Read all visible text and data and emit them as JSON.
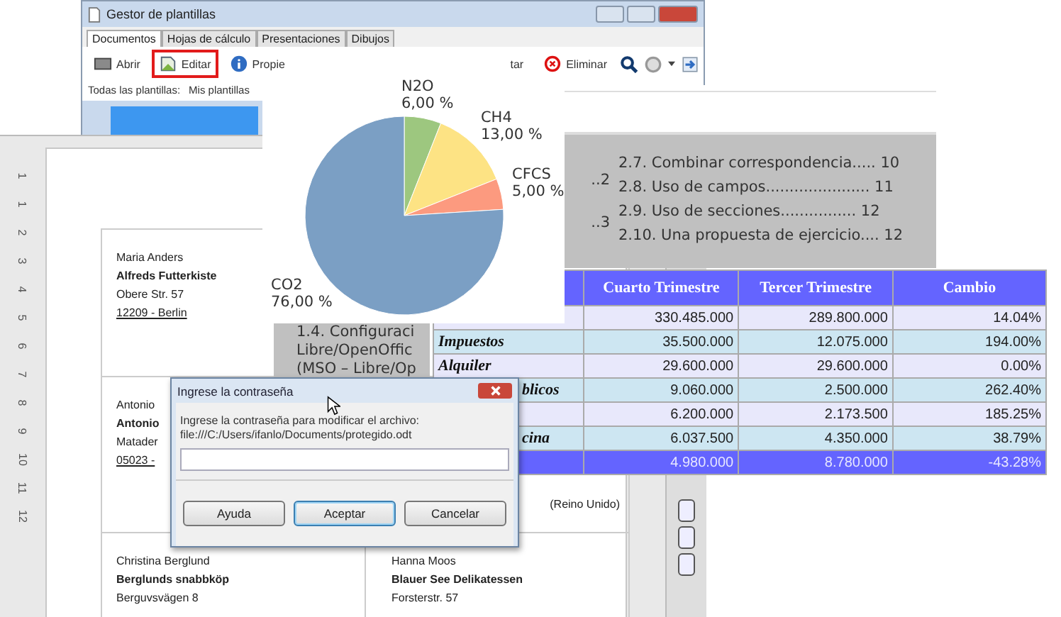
{
  "template_manager": {
    "title": "Gestor de plantillas",
    "tabs": [
      {
        "label": "Documentos",
        "selected": true
      },
      {
        "label": "Hojas de cálculo",
        "selected": false
      },
      {
        "label": "Presentaciones",
        "selected": false
      },
      {
        "label": "Dibujos",
        "selected": false
      }
    ],
    "toolbar": [
      {
        "label": "Abrir",
        "highlighted": false
      },
      {
        "label": "Editar",
        "highlighted": true
      },
      {
        "label": "Propie",
        "highlighted": false
      }
    ],
    "toolbar_right": [
      {
        "label": "tar"
      },
      {
        "label": "Eliminar"
      }
    ],
    "breadcrumb": [
      "Todas las plantillas:",
      "Mis plantillas"
    ]
  },
  "document": {
    "ruler": [
      "1",
      "1",
      "2",
      "3",
      "4",
      "5",
      "6",
      "7",
      "8",
      "9",
      "10",
      "11",
      "12"
    ],
    "rows": [
      {
        "left": {
          "lines": [
            {
              "text": "Maria Anders",
              "kind": "name"
            },
            {
              "text": "Alfreds Futterkiste",
              "kind": "company"
            },
            {
              "text": "Obere Str. 57",
              "kind": "street"
            },
            {
              "text": "12209 - Berlin",
              "kind": "city"
            }
          ]
        },
        "right": {}
      },
      {
        "left": {
          "lines": [
            {
              "text": "Antonio",
              "kind": "name"
            },
            {
              "text": "Antonio",
              "kind": "company"
            },
            {
              "text": "Matader",
              "kind": "street"
            },
            {
              "text": "05023 -",
              "kind": "city"
            }
          ]
        },
        "right": {
          "lines": [
            {
              "text": "(Reino Unido)",
              "kind": "country"
            }
          ]
        }
      },
      {
        "left": {
          "lines": [
            {
              "text": "Christina Berglund",
              "kind": "name"
            },
            {
              "text": "Berglunds snabbköp",
              "kind": "company"
            },
            {
              "text": "Berguvsvägen 8",
              "kind": "street"
            }
          ]
        },
        "right": {
          "lines": [
            {
              "text": "Hanna Moos",
              "kind": "name"
            },
            {
              "text": "Blauer See Delikatessen",
              "kind": "company"
            },
            {
              "text": "Forsterstr. 57",
              "kind": "street"
            }
          ]
        }
      }
    ]
  },
  "toc": {
    "left_stubs": [
      "..2",
      "..3"
    ],
    "entries": [
      "2.7. Combinar correspondencia..... 10",
      "2.8. Uso de campos...................... 11",
      "2.9. Uso de secciones................ 12",
      "2.10. Una propuesta de ejercicio.... 12"
    ],
    "fragment": [
      "1.4. Configuraci",
      "Libre/OpenOffic",
      "(MSO – Libre/Op"
    ]
  },
  "table": {
    "columns": [
      "Cuarto Trimestre",
      "Tercer Trimestre",
      "Cambio"
    ],
    "rows": [
      {
        "kind": "plain",
        "cells": [
          "330.485.000",
          "289.800.000",
          "14.04%"
        ]
      },
      {
        "kind": "plain",
        "label": "Impuestos",
        "cells": [
          "35.500.000",
          "12.075.000",
          "194.00%"
        ]
      },
      {
        "kind": "plain",
        "label": "Alquiler",
        "cells": [
          "29.600.000",
          "29.600.000",
          "0.00%"
        ]
      },
      {
        "kind": "covered",
        "label": "blicos",
        "cells": [
          "9.060.000",
          "2.500.000",
          "262.40%"
        ]
      },
      {
        "kind": "plain",
        "cells": [
          "6.200.000",
          "2.173.500",
          "185.25%"
        ]
      },
      {
        "kind": "covered",
        "label": "cina",
        "cells": [
          "6.037.500",
          "4.350.000",
          "38.79%"
        ]
      },
      {
        "kind": "total",
        "cells": [
          "4.980.000",
          "8.780.000",
          "-43.28%"
        ]
      }
    ]
  },
  "pie": {
    "chart_data": {
      "type": "pie",
      "categories": [
        "N2O",
        "CH4",
        "CFCS",
        "CO2"
      ],
      "values": [
        6,
        13,
        5,
        76
      ],
      "colors": [
        "#9dc77f",
        "#fde384",
        "#fc9a7f",
        "#7b9fc4"
      ],
      "value_labels": [
        "6,00 %",
        "13,00 %",
        "5,00 %",
        "76,00 %"
      ]
    }
  },
  "dialog": {
    "title": "Ingrese la contraseña",
    "message": "Ingrese la contraseña para modificar el archivo:",
    "path": "file:///C:/Users/ifanlo/Documents/protegido.odt",
    "buttons": [
      {
        "label": "Ayuda",
        "focused": false
      },
      {
        "label": "Aceptar",
        "focused": true
      },
      {
        "label": "Cancelar",
        "focused": false
      }
    ]
  }
}
